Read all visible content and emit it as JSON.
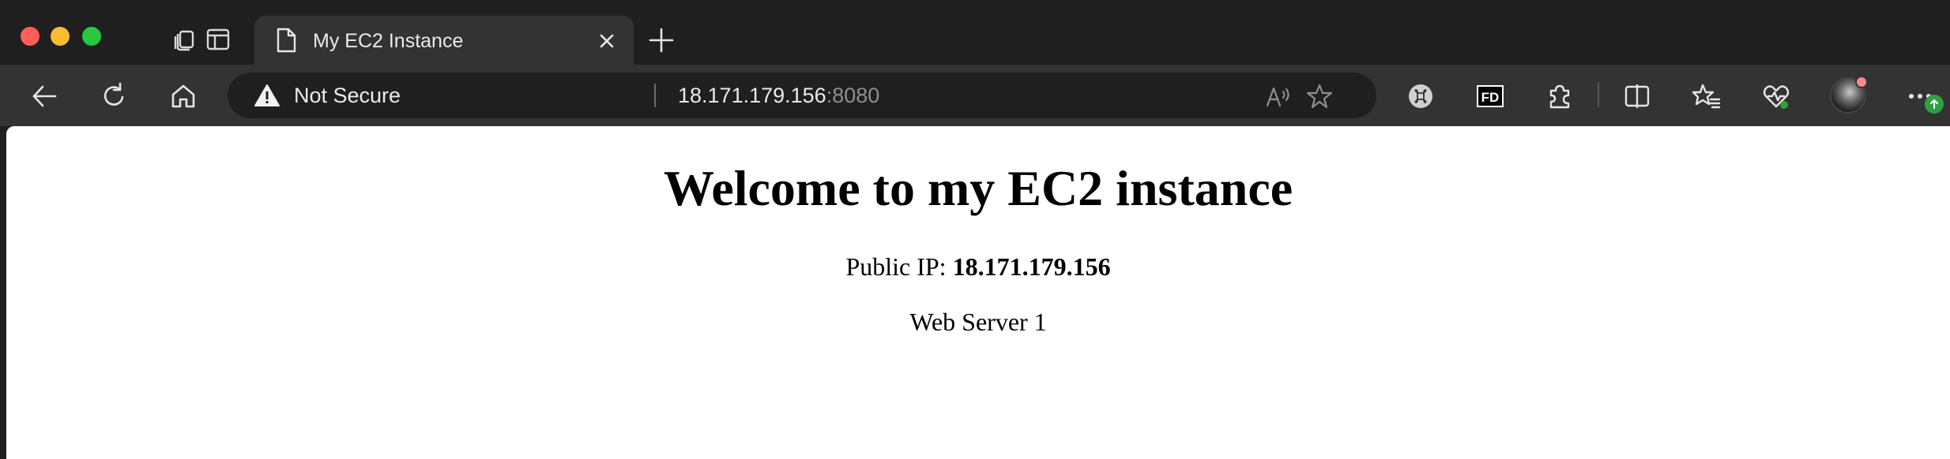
{
  "browser": {
    "tab": {
      "title": "My EC2 Instance"
    },
    "address_bar": {
      "security_label": "Not Secure",
      "url_host": "18.171.179.156",
      "url_port": ":8080"
    },
    "extensions": {
      "fd_label": "FD"
    }
  },
  "page": {
    "heading": "Welcome to my EC2 instance",
    "ip_label": "Public IP:",
    "ip_value": "18.171.179.156",
    "server_label": "Web Server 1"
  }
}
